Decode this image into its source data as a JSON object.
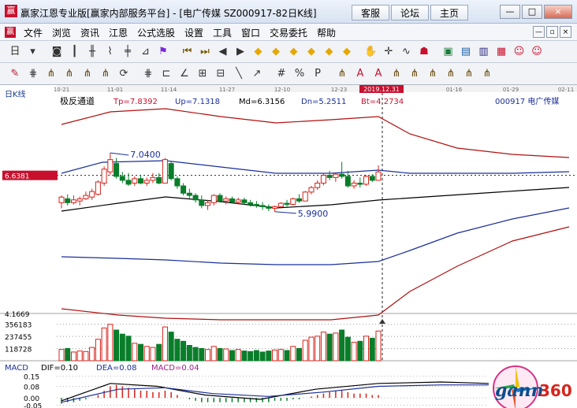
{
  "window": {
    "app_title": "赢家江恩专业版[赢家内部服务平台] - [电广传媒 SZ000917-82日K线]",
    "buttons": [
      "客服",
      "论坛",
      "主页"
    ],
    "controls": [
      "—",
      "□",
      "×"
    ]
  },
  "menu": {
    "items": [
      "文件",
      "浏览",
      "资讯",
      "江恩",
      "公式选股",
      "设置",
      "工具",
      "窗口",
      "交易委托",
      "帮助"
    ],
    "mdi_controls": [
      "—",
      "▫",
      "×"
    ]
  },
  "toolbar1": {
    "icons": [
      "period-icon",
      "dropdown-arrow-icon",
      "camera-icon",
      "bar-chart-icon",
      "candle-chart-icon",
      "line-chart-icon",
      "candle-single-icon",
      "gann-fan-icon",
      "flag-icon",
      "first-icon",
      "last-icon",
      "prev-icon",
      "next-icon",
      "diamond-icon",
      "diamond-icon",
      "diamond-icon",
      "diamond-icon",
      "diamond-icon",
      "diamond-icon",
      "hand-icon",
      "crosshair-icon",
      "wave-icon",
      "mask-icon",
      "info-icon",
      "ledger-icon",
      "book-icon",
      "save-icon",
      "people-icon",
      "people-icon"
    ]
  },
  "toolbar2": {
    "icons": [
      "pencil-icon",
      "hash-grid-icon",
      "fork-icon",
      "fork-icon",
      "fork-icon",
      "fork-icon",
      "cycle-icon",
      "hash-grid-icon",
      "bracket-icon",
      "angle-icon",
      "ruler-icon",
      "box-icon",
      "slash-icon",
      "ray-icon",
      "hash-icon",
      "percent-icon",
      "p-icon",
      "fork-icon",
      "text-a-icon",
      "text-a-icon",
      "fork-icon",
      "fork-icon",
      "fork-icon",
      "fork-icon",
      "fork-icon",
      "fork-icon"
    ]
  },
  "chart_data": {
    "type": "candlestick",
    "period_label": "日K线",
    "indicator": "极反通道",
    "values_header": {
      "tp": "Tp=7.8392",
      "up": "Up=7.1318",
      "md": "Md=6.3156",
      "dn": "Dn=5.2511",
      "bt": "Bt=4.2734"
    },
    "stock": "000917 电广传媒",
    "cursor_date": "2019.12.31",
    "cursor_price": "6.6381",
    "date_ticks": [
      "10-21",
      "11-01",
      "11-14",
      "11-27",
      "12-10",
      "12-23",
      "01-16",
      "01-29",
      "02-11"
    ],
    "annotation_high": "7.0400",
    "annotation_low": "5.9900",
    "price_axis_min": "4.1669",
    "volume_ticks": [
      "356183",
      "237455",
      "118728"
    ],
    "macd": {
      "name": "MACD",
      "dif": "DIF=0.10",
      "dea": "DEA=0.08",
      "macd": "MACD=0.04",
      "ticks": [
        "0.15",
        "0.08",
        "0.00",
        "-0.05"
      ]
    },
    "candles": [
      {
        "o": 6.15,
        "h": 6.28,
        "l": 6.05,
        "c": 6.25
      },
      {
        "o": 6.22,
        "h": 6.3,
        "l": 6.1,
        "c": 6.15
      },
      {
        "o": 6.15,
        "h": 6.28,
        "l": 6.12,
        "c": 6.2
      },
      {
        "o": 6.18,
        "h": 6.26,
        "l": 6.1,
        "c": 6.22
      },
      {
        "o": 6.22,
        "h": 6.35,
        "l": 6.2,
        "c": 6.28
      },
      {
        "o": 6.25,
        "h": 6.4,
        "l": 6.2,
        "c": 6.35
      },
      {
        "o": 6.3,
        "h": 6.55,
        "l": 6.28,
        "c": 6.52
      },
      {
        "o": 6.5,
        "h": 6.8,
        "l": 6.45,
        "c": 6.75
      },
      {
        "o": 6.7,
        "h": 7.04,
        "l": 6.65,
        "c": 6.92
      },
      {
        "o": 6.85,
        "h": 6.95,
        "l": 6.58,
        "c": 6.62
      },
      {
        "o": 6.62,
        "h": 6.7,
        "l": 6.5,
        "c": 6.55
      },
      {
        "o": 6.55,
        "h": 6.68,
        "l": 6.45,
        "c": 6.48
      },
      {
        "o": 6.5,
        "h": 6.62,
        "l": 6.45,
        "c": 6.58
      },
      {
        "o": 6.58,
        "h": 6.65,
        "l": 6.48,
        "c": 6.5
      },
      {
        "o": 6.5,
        "h": 6.6,
        "l": 6.45,
        "c": 6.55
      },
      {
        "o": 6.55,
        "h": 6.68,
        "l": 6.5,
        "c": 6.6
      },
      {
        "o": 6.6,
        "h": 6.68,
        "l": 6.48,
        "c": 6.5
      },
      {
        "o": 6.5,
        "h": 6.95,
        "l": 6.5,
        "c": 6.92
      },
      {
        "o": 6.85,
        "h": 6.9,
        "l": 6.55,
        "c": 6.58
      },
      {
        "o": 6.58,
        "h": 6.62,
        "l": 6.4,
        "c": 6.45
      },
      {
        "o": 6.45,
        "h": 6.5,
        "l": 6.28,
        "c": 6.32
      },
      {
        "o": 6.32,
        "h": 6.4,
        "l": 6.22,
        "c": 6.28
      },
      {
        "o": 6.28,
        "h": 6.32,
        "l": 6.15,
        "c": 6.2
      },
      {
        "o": 6.2,
        "h": 6.28,
        "l": 6.05,
        "c": 6.1
      },
      {
        "o": 6.1,
        "h": 6.2,
        "l": 6.02,
        "c": 6.15
      },
      {
        "o": 6.15,
        "h": 6.3,
        "l": 6.1,
        "c": 6.28
      },
      {
        "o": 6.28,
        "h": 6.32,
        "l": 6.15,
        "c": 6.18
      },
      {
        "o": 6.18,
        "h": 6.26,
        "l": 6.12,
        "c": 6.22
      },
      {
        "o": 6.22,
        "h": 6.26,
        "l": 6.14,
        "c": 6.16
      },
      {
        "o": 6.16,
        "h": 6.24,
        "l": 6.12,
        "c": 6.2
      },
      {
        "o": 6.2,
        "h": 6.24,
        "l": 6.12,
        "c": 6.15
      },
      {
        "o": 6.15,
        "h": 6.2,
        "l": 6.08,
        "c": 6.12
      },
      {
        "o": 6.12,
        "h": 6.18,
        "l": 6.06,
        "c": 6.1
      },
      {
        "o": 6.1,
        "h": 6.16,
        "l": 6.02,
        "c": 6.08
      },
      {
        "o": 6.08,
        "h": 6.12,
        "l": 6.0,
        "c": 6.05
      },
      {
        "o": 6.05,
        "h": 6.1,
        "l": 5.99,
        "c": 6.08
      },
      {
        "o": 6.08,
        "h": 6.16,
        "l": 6.05,
        "c": 6.14
      },
      {
        "o": 6.14,
        "h": 6.2,
        "l": 6.08,
        "c": 6.12
      },
      {
        "o": 6.12,
        "h": 6.24,
        "l": 6.1,
        "c": 6.22
      },
      {
        "o": 6.22,
        "h": 6.3,
        "l": 6.15,
        "c": 6.18
      },
      {
        "o": 6.18,
        "h": 6.36,
        "l": 6.18,
        "c": 6.34
      },
      {
        "o": 6.34,
        "h": 6.45,
        "l": 6.3,
        "c": 6.42
      },
      {
        "o": 6.42,
        "h": 6.55,
        "l": 6.38,
        "c": 6.5
      },
      {
        "o": 6.5,
        "h": 6.68,
        "l": 6.46,
        "c": 6.64
      },
      {
        "o": 6.64,
        "h": 6.72,
        "l": 6.55,
        "c": 6.6
      },
      {
        "o": 6.6,
        "h": 6.68,
        "l": 6.52,
        "c": 6.66
      },
      {
        "o": 6.66,
        "h": 6.88,
        "l": 6.58,
        "c": 6.62
      },
      {
        "o": 6.62,
        "h": 6.72,
        "l": 6.42,
        "c": 6.45
      },
      {
        "o": 6.45,
        "h": 6.55,
        "l": 6.4,
        "c": 6.5
      },
      {
        "o": 6.5,
        "h": 6.6,
        "l": 6.42,
        "c": 6.48
      },
      {
        "o": 6.48,
        "h": 6.64,
        "l": 6.45,
        "c": 6.62
      },
      {
        "o": 6.62,
        "h": 6.66,
        "l": 6.52,
        "c": 6.55
      },
      {
        "o": 6.55,
        "h": 6.82,
        "l": 6.55,
        "c": 6.7
      }
    ],
    "volumes": [
      110000,
      120000,
      85000,
      95000,
      90000,
      130000,
      210000,
      320000,
      356183,
      300000,
      260000,
      240000,
      170000,
      160000,
      140000,
      130000,
      160000,
      330000,
      280000,
      210000,
      190000,
      150000,
      130000,
      120000,
      110000,
      140000,
      120000,
      115000,
      100000,
      110000,
      95000,
      90000,
      100000,
      85000,
      95000,
      105000,
      110000,
      100000,
      140000,
      120000,
      200000,
      230000,
      240000,
      280000,
      260000,
      270000,
      300000,
      230000,
      180000,
      190000,
      240000,
      220000,
      290000
    ],
    "macd_bars": [
      -0.04,
      -0.03,
      -0.03,
      -0.02,
      -0.01,
      0.0,
      0.02,
      0.05,
      0.08,
      0.09,
      0.08,
      0.07,
      0.06,
      0.05,
      0.05,
      0.04,
      0.04,
      0.05,
      0.04,
      0.02,
      0.0,
      -0.01,
      -0.02,
      -0.03,
      -0.03,
      -0.03,
      -0.03,
      -0.03,
      -0.03,
      -0.03,
      -0.03,
      -0.03,
      -0.03,
      -0.03,
      -0.03,
      -0.02,
      -0.02,
      -0.02,
      -0.01,
      -0.01,
      0.0,
      0.01,
      0.02,
      0.03,
      0.04,
      0.05,
      0.05,
      0.04,
      0.03,
      0.03,
      0.03,
      0.02,
      0.02
    ]
  }
}
